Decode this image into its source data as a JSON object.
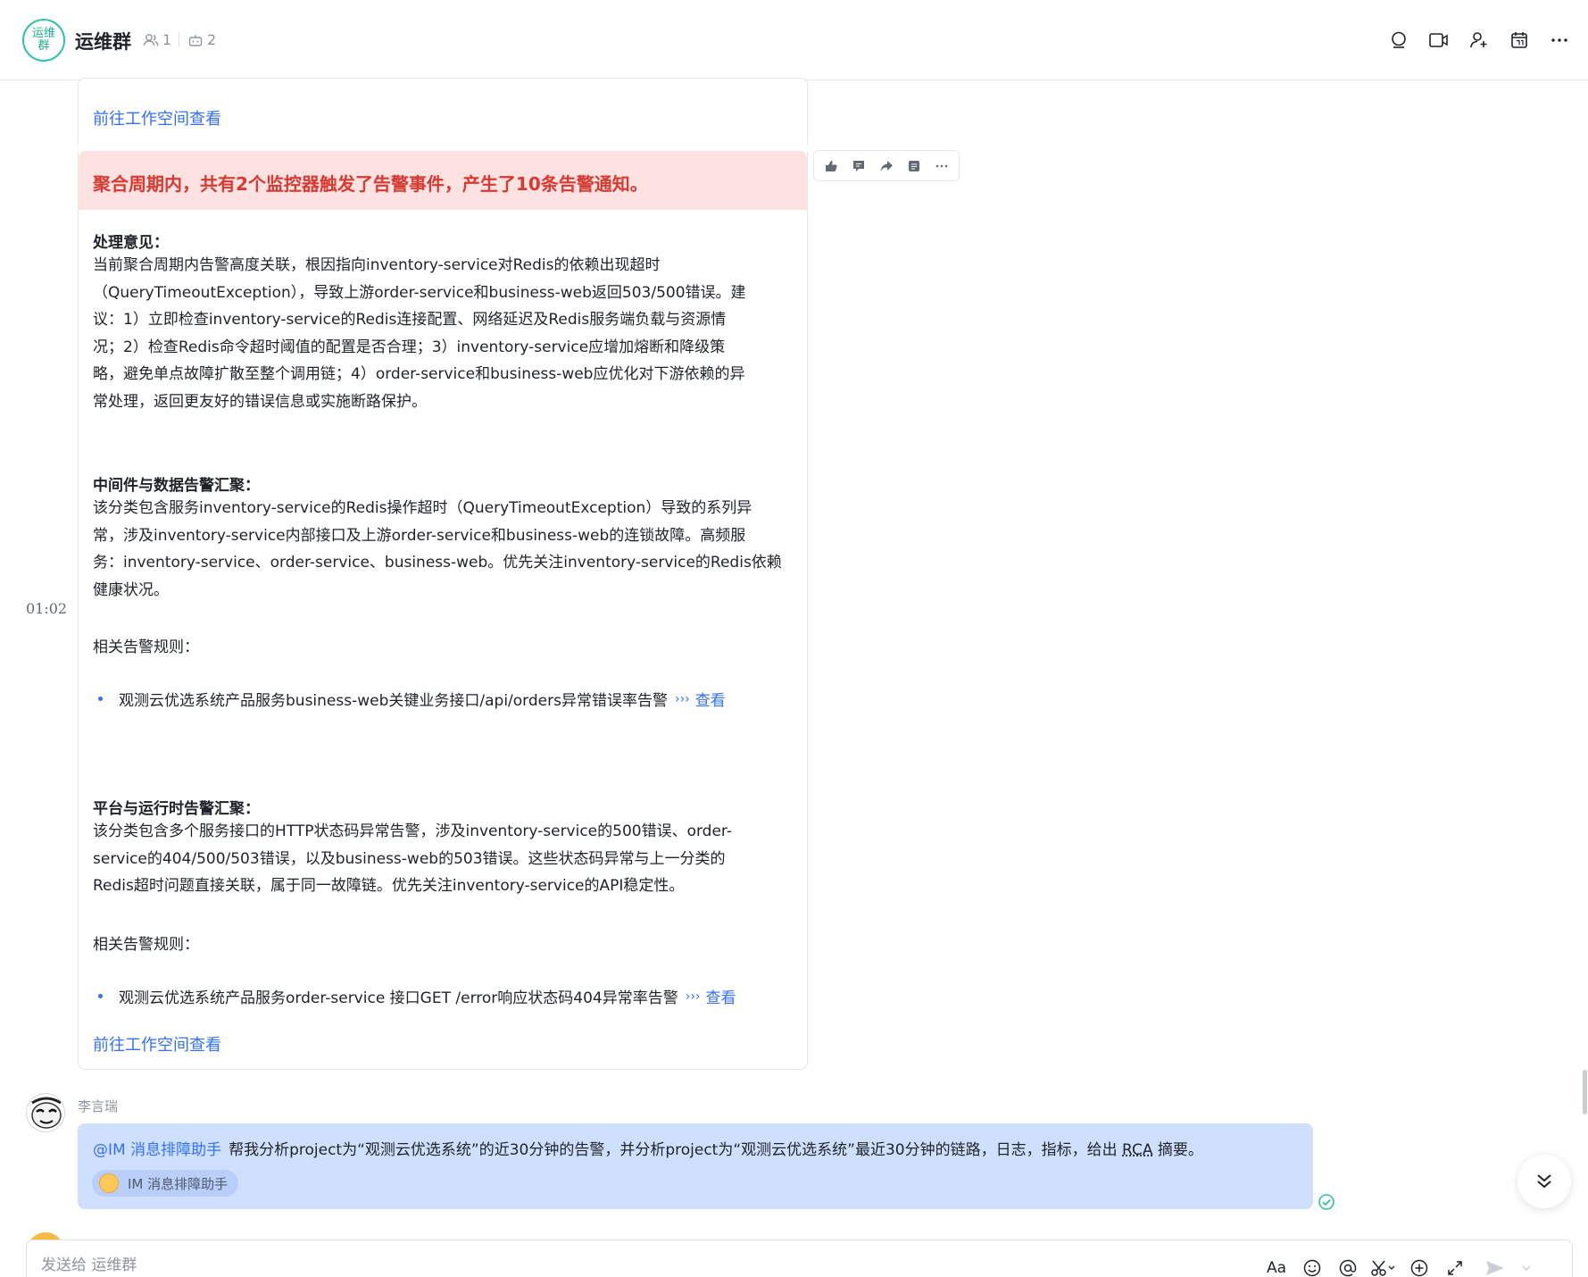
{
  "header": {
    "group_avatar_text": "运维群",
    "title": "运维群",
    "member_count": "1",
    "bot_count": "2"
  },
  "timestamp": "01:02",
  "card": {
    "top_link": "前往工作空间查看",
    "alert_title": "聚合周期内，共有2个监控器触发了告警事件，产生了10条告警通知。",
    "handling": {
      "title": "处理意见：",
      "lines": [
        "当前聚合周期内告警高度关联，根因指向inventory-service对Redis的依赖出现超时",
        "（QueryTimeoutException），导致上游order-service和business-web返回503/500错误。建",
        "议：1）立即检查inventory-service的Redis连接配置、网络延迟及Redis服务端负载与资源情",
        "况；2）检查Redis命令超时阈值的配置是否合理；3）inventory-service应增加熔断和降级策",
        "略，避免单点故障扩散至整个调用链；4）order-service和business-web应优化对下游依赖的异",
        "常处理，返回更友好的错误信息或实施断路保护。"
      ]
    },
    "middleware": {
      "title": "中间件与数据告警汇聚：",
      "lines": [
        "该分类包含服务inventory-service的Redis操作超时（QueryTimeoutException）导致的系列异",
        "常，涉及inventory-service内部接口及上游order-service和business-web的连锁故障。高频服",
        "务：inventory-service、order-service、business-web。优先关注inventory-service的Redis依赖",
        "健康状况。"
      ],
      "rules_label": "相关告警规则：",
      "rule": "观测云优选系统产品服务business-web关键业务接口/api/orders异常错误率告警",
      "view_label": "查看"
    },
    "platform": {
      "title": "平台与运行时告警汇聚：",
      "lines": [
        "该分类包含多个服务接口的HTTP状态码异常告警，涉及inventory-service的500错误、order-",
        "service的404/500/503错误，以及business-web的503错误。这些状态码异常与上一分类的",
        "Redis超时问题直接关联，属于同一故障链。优先关注inventory-service的API稳定性。"
      ],
      "rules_label": "相关告警规则：",
      "rule": "观测云优选系统产品服务order-service 接口GET /error响应状态码404异常率告警",
      "view_label": "查看"
    },
    "bottom_link": "前往工作空间查看"
  },
  "message": {
    "sender": "李言瑞",
    "mention": "@IM 消息排障助手",
    "text_before_rca": "帮我分析project为“观测云优选系统”的近30分钟的告警，并分析project为“观测云优选系统”最近30分钟的链路，日志，指标，给出 ",
    "rca": "RCA",
    "text_after_rca": " 摘要。",
    "bot_chip": "IM 消息排障助手"
  },
  "input": {
    "placeholder": "发送给 运维群",
    "font_button": "Aa"
  }
}
